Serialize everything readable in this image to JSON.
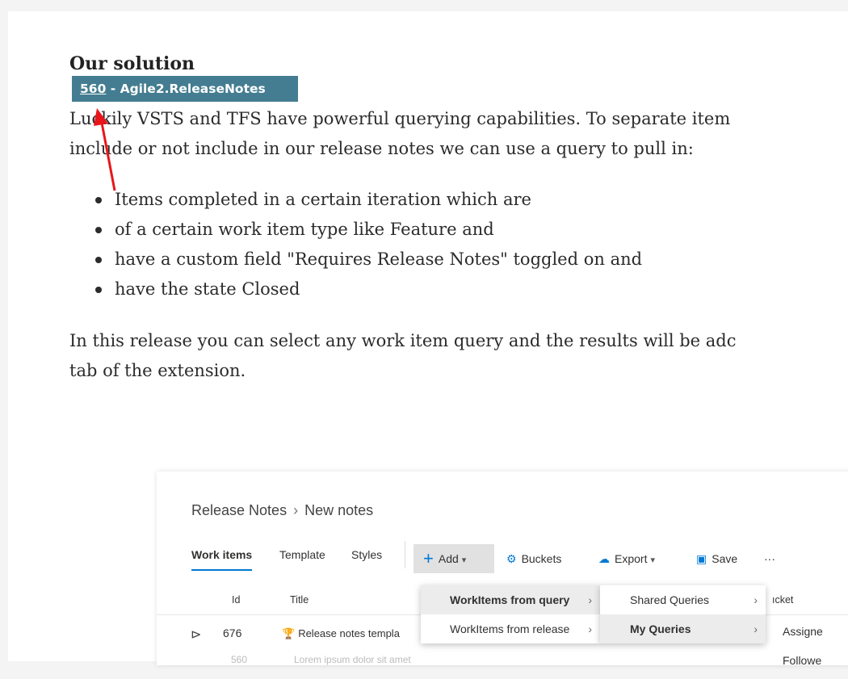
{
  "article": {
    "heading": "Our solution",
    "badge": {
      "id": "560",
      "rest": " - Agile2.ReleaseNotes"
    },
    "paragraph1": [
      "Luckily VSTS and TFS have powerful querying capabilities. To separate item",
      "include or not include in our release notes we can use a query to pull in:"
    ],
    "bullets": [
      "Items completed in a certain iteration which are",
      "of a certain work item type like Feature and",
      "have a custom field \"Requires Release Notes\" toggled on and",
      "have the state Closed"
    ],
    "paragraph2": [
      "In this release you can select any work item query and the results will be adc",
      "tab of the extension."
    ]
  },
  "screenshot": {
    "breadcrumb": {
      "root": "Release Notes",
      "current": "New notes",
      "sep": "›"
    },
    "tabs": [
      "Work items",
      "Template",
      "Styles"
    ],
    "toolbar": {
      "add": "Add",
      "buckets": "Buckets",
      "export": "Export",
      "save": "Save",
      "more": "···",
      "icons": {
        "add": "plus-icon",
        "buckets": "gear-icon",
        "export": "cloud-icon",
        "save": "save-icon"
      }
    },
    "columns": {
      "id": "Id",
      "title": "Title",
      "bucket": "ıcket"
    },
    "row": {
      "id": "676",
      "title": "Release notes templa"
    },
    "ghost_row": {
      "id": "560",
      "title": "Lorem ipsum dolor sit amet"
    },
    "menu1": [
      "WorkItems from query",
      "WorkItems from release"
    ],
    "menu2": [
      "Shared Queries",
      "My Queries"
    ],
    "menu3": [
      "Assigne",
      "Followe"
    ]
  },
  "colors": {
    "badge": "#447d91",
    "accent": "#0078d4",
    "arrow": "#e8161b"
  }
}
